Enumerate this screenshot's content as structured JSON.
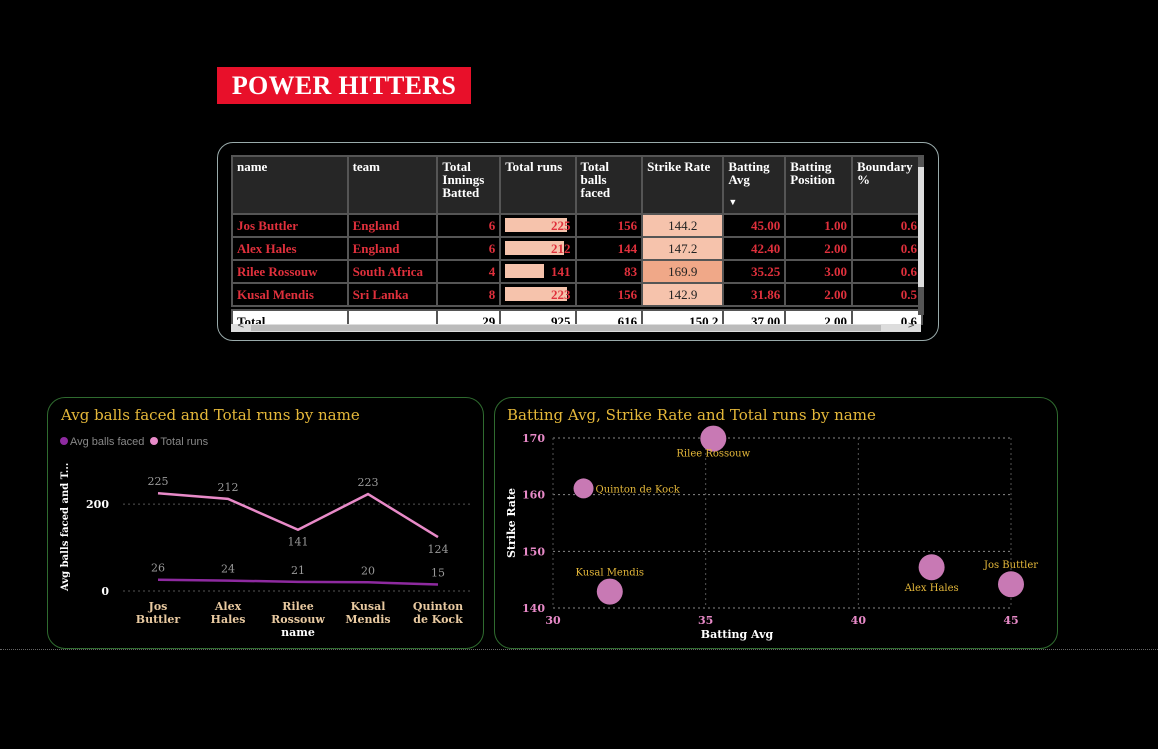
{
  "header": {
    "title": "POWER HITTERS"
  },
  "table": {
    "columns": [
      "name",
      "team",
      "Total Innings Batted",
      "Total runs",
      "Total balls faced",
      "Strike Rate",
      "Batting Avg",
      "Batting Position",
      "Boundary %"
    ],
    "rows": [
      {
        "name": "Jos Buttler",
        "team": "England",
        "innings": "6",
        "runs": "225",
        "balls": "156",
        "sr": "144.2",
        "avg": "45.00",
        "pos": "1.00",
        "boundary": "0.6"
      },
      {
        "name": "Alex Hales",
        "team": "England",
        "innings": "6",
        "runs": "212",
        "balls": "144",
        "sr": "147.2",
        "avg": "42.40",
        "pos": "2.00",
        "boundary": "0.6"
      },
      {
        "name": "Rilee Rossouw",
        "team": "South Africa",
        "innings": "4",
        "runs": "141",
        "balls": "83",
        "sr": "169.9",
        "avg": "35.25",
        "pos": "3.00",
        "boundary": "0.6"
      },
      {
        "name": "Kusal Mendis",
        "team": "Sri Lanka",
        "innings": "8",
        "runs": "223",
        "balls": "156",
        "sr": "142.9",
        "avg": "31.86",
        "pos": "2.00",
        "boundary": "0.5"
      }
    ],
    "total": {
      "label": "Total",
      "team": "",
      "innings": "29",
      "runs": "925",
      "balls": "616",
      "sr": "150.2",
      "avg": "37.00",
      "pos": "2.00",
      "boundary": "0.6"
    },
    "runs_bar_max": 225
  },
  "line_chart": {
    "title": "Avg balls faced and Total runs by name",
    "legend": [
      {
        "name": "Avg balls faced",
        "color": "#8e2aa0"
      },
      {
        "name": "Total runs",
        "color": "#e88ac8"
      }
    ],
    "ylabel": "Avg balls faced and T...",
    "xlabel": "name",
    "yticks": [
      "0",
      "200"
    ]
  },
  "scatter_chart": {
    "title": "Batting Avg, Strike Rate and Total runs by name",
    "xlabel": "Batting Avg",
    "ylabel": "Strike Rate",
    "xticks": [
      "30",
      "35",
      "40",
      "45"
    ],
    "yticks": [
      "140",
      "150",
      "160",
      "170"
    ]
  },
  "chart_data": [
    {
      "type": "line",
      "title": "Avg balls faced and Total runs by name",
      "categories": [
        "Jos Buttler",
        "Alex Hales",
        "Rilee Rossouw",
        "Kusal Mendis",
        "Quinton de Kock"
      ],
      "series": [
        {
          "name": "Total runs",
          "values": [
            225,
            212,
            141,
            223,
            124
          ],
          "color": "#e88ac8"
        },
        {
          "name": "Avg balls faced",
          "values": [
            26,
            24,
            21,
            20,
            15
          ],
          "color": "#8e2aa0"
        }
      ],
      "xlabel": "name",
      "ylabel": "Avg balls faced and T...",
      "ylim": [
        0,
        260
      ]
    },
    {
      "type": "scatter",
      "title": "Batting Avg, Strike Rate and Total runs by name",
      "xlabel": "Batting Avg",
      "ylabel": "Strike Rate",
      "xlim": [
        30,
        45
      ],
      "ylim": [
        140,
        170
      ],
      "points": [
        {
          "label": "Rilee Rossouw",
          "x": 35.25,
          "y": 169.9
        },
        {
          "label": "Quinton de Kock",
          "x": 31.0,
          "y": 161.1
        },
        {
          "label": "Kusal Mendis",
          "x": 31.86,
          "y": 142.9
        },
        {
          "label": "Alex Hales",
          "x": 42.4,
          "y": 147.2
        },
        {
          "label": "Jos Buttler",
          "x": 45.0,
          "y": 144.2
        }
      ],
      "color": "#c879b4"
    }
  ]
}
